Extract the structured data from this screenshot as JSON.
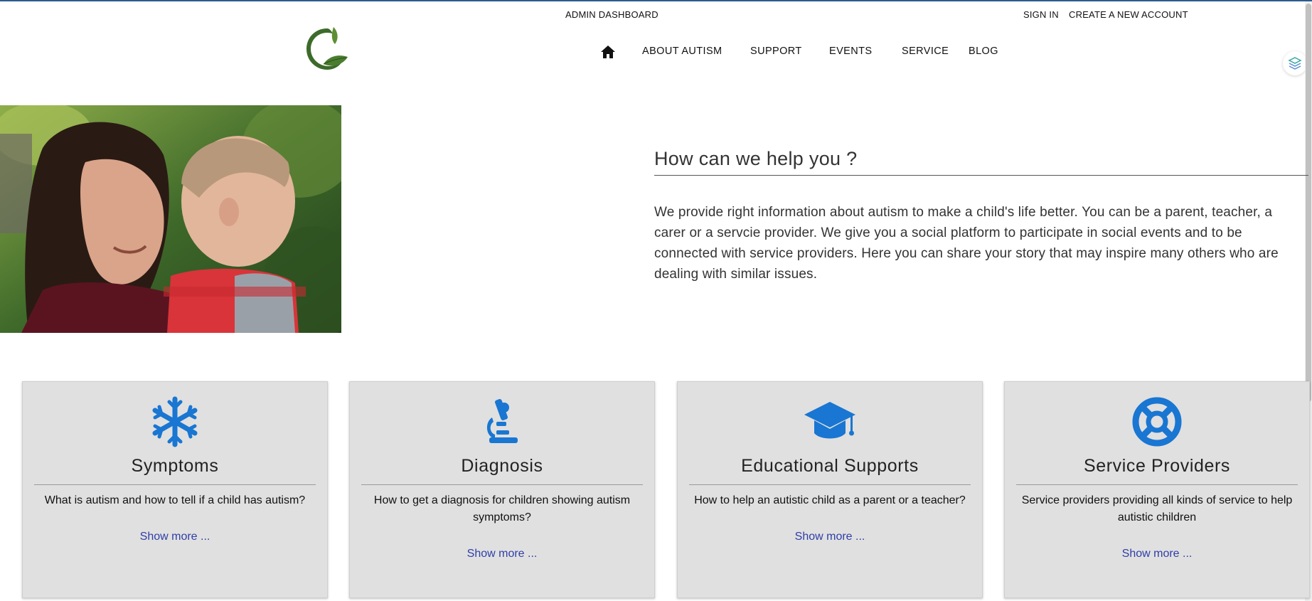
{
  "header": {
    "admin_label": "ADMIN DASHBOARD",
    "sign_in_label": "SIGN IN",
    "create_account_label": "CREATE A NEW ACCOUNT"
  },
  "nav": {
    "home_icon": "home-icon",
    "items": [
      {
        "label": "ABOUT AUTISM"
      },
      {
        "label": "SUPPORT"
      },
      {
        "label": "EVENTS"
      },
      {
        "label": "SERVICE"
      },
      {
        "label": "BLOG"
      }
    ]
  },
  "intro": {
    "title": "How can we help you ?",
    "body": "We provide right information about autism to make a child's life better. You can be a parent, teacher, a carer or a servcie provider. We give you a social platform to participate in social events and to be connected with service providers. Here you can share your story that may inspire many others who are dealing with similar issues."
  },
  "cards": [
    {
      "icon": "snowflake-icon",
      "title": "Symptoms",
      "description": "What is autism and how to tell if a child has autism?",
      "link": "Show more ..."
    },
    {
      "icon": "microscope-icon",
      "title": "Diagnosis",
      "description": "How to get a diagnosis for children showing autism symptoms?",
      "link": "Show more ..."
    },
    {
      "icon": "graduation-cap-icon",
      "title": "Educational Supports",
      "description": "How to help an autistic child as a parent or a teacher?",
      "link": "Show more ..."
    },
    {
      "icon": "life-ring-icon",
      "title": "Service Providers",
      "description": "Service providers providing all kinds of service to help autistic children",
      "link": "Show more ..."
    }
  ],
  "colors": {
    "accent_blue": "#1976d2",
    "link_blue": "#2f3ea8",
    "card_bg": "#e0e0e0",
    "logo_green": "#3d6b2a",
    "top_border": "#2a5d8f"
  }
}
